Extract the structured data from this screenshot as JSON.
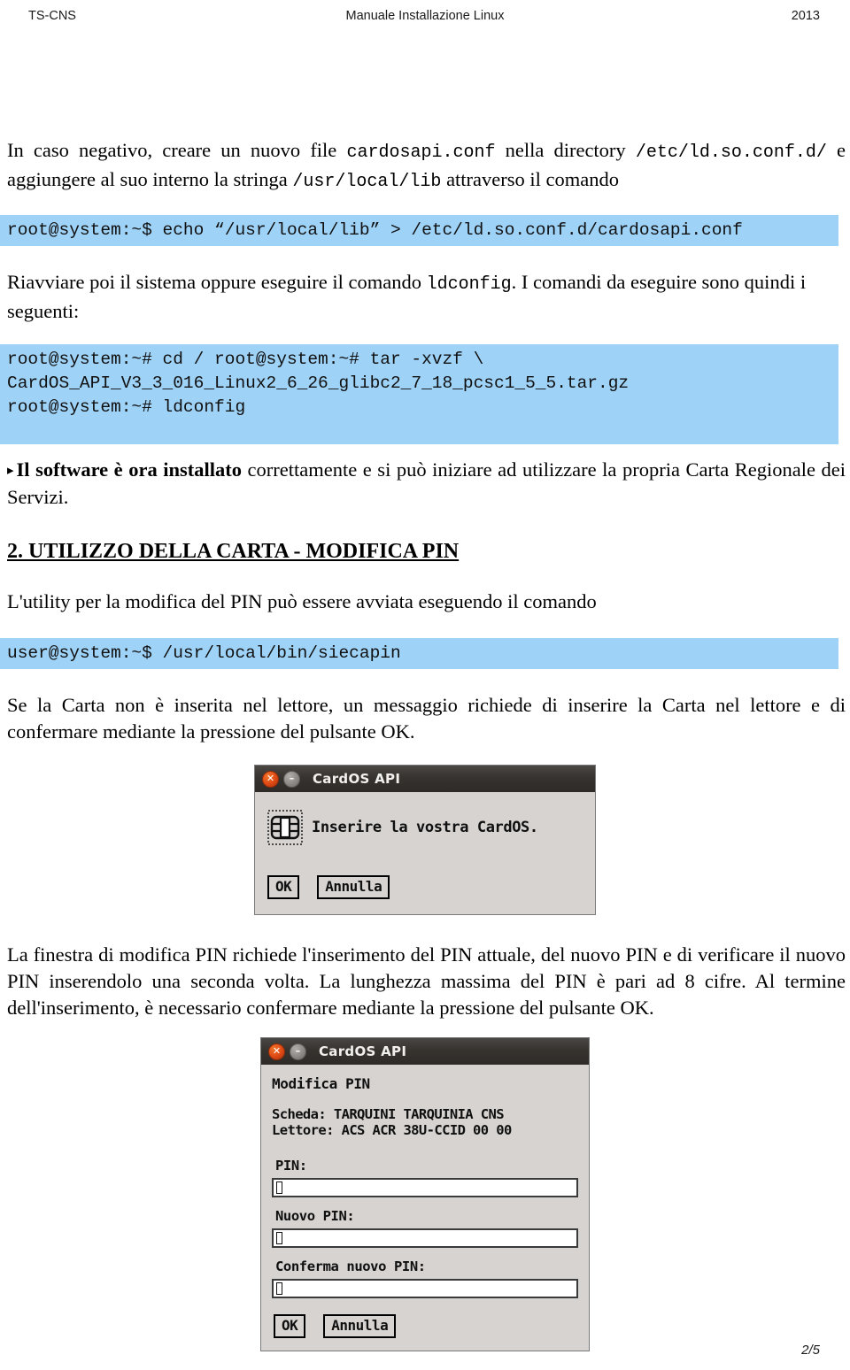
{
  "header": {
    "left": "TS-CNS",
    "center": "Manuale Installazione Linux",
    "right": "2013"
  },
  "body": {
    "para1_a": "In caso negativo, creare un nuovo file ",
    "para1_code1": "cardosapi.conf",
    "para1_b": " nella directory ",
    "para1_code2": "/etc/ld.so.conf.d/",
    "para1_c": " e aggiungere al suo interno la stringa ",
    "para1_code3": "/usr/local/lib",
    "para1_d": " attraverso il comando",
    "code1": "root@system:~$ echo “/usr/local/lib” > /etc/ld.so.conf.d/cardosapi.conf",
    "para2_a": "Riavviare poi il sistema oppure eseguire il comando ",
    "para2_code": "ldconfig",
    "para2_b": ". I comandi da eseguire sono quindi i seguenti:",
    "code2": "root@system:~# cd / root@system:~# tar -xvzf \\\nCardOS_API_V3_3_016_Linux2_6_26_glibc2_7_18_pcsc1_5_5.tar.gz\nroot@system:~# ldconfig",
    "bullet_marker": "▸",
    "bullet_bold": "Il software è ora installato",
    "bullet_rest": " correttamente e si può iniziare ad utilizzare la propria Carta Regionale dei Servizi.",
    "section_title": "2. UTILIZZO DELLA CARTA - MODIFICA PIN",
    "para3": "L'utility per la modifica del PIN può essere avviata eseguendo il comando",
    "code3": "user@system:~$ /usr/local/bin/siecapin",
    "para4": "Se la Carta non è inserita nel lettore, un messaggio richiede di inserire la Carta nel lettore e di confermare mediante la pressione del pulsante OK.",
    "para5": "La finestra di modifica PIN richiede l'inserimento del PIN attuale, del nuovo PIN e di verificare il nuovo PIN inserendolo una seconda volta. La lunghezza massima del PIN è pari ad 8 cifre. Al termine dell'inserimento, è necessario confermare mediante la pressione del pulsante OK."
  },
  "dialog_insert": {
    "title": "CardOS API",
    "close_glyph": "✕",
    "minimize_glyph": "–",
    "icon": "smartcard-chip-icon",
    "message": "Inserire la vostra CardOS.",
    "ok_label": "OK",
    "cancel_label": "Annulla"
  },
  "dialog_pin": {
    "title": "CardOS API",
    "close_glyph": "✕",
    "minimize_glyph": "–",
    "heading": "Modifica PIN",
    "card_line": "Scheda: TARQUINI TARQUINIA CNS",
    "reader_line": "Lettore: ACS ACR 38U-CCID 00 00",
    "pin_label": "PIN:",
    "pin_value": "",
    "new_pin_label": "Nuovo PIN:",
    "new_pin_value": "",
    "confirm_pin_label": "Conferma nuovo PIN:",
    "confirm_pin_value": "",
    "ok_label": "OK",
    "cancel_label": "Annulla"
  },
  "footer": {
    "page_number": "2/5"
  },
  "colors": {
    "code_highlight": "#9fd2f7",
    "titlebar": "#37332f",
    "close_button": "#dd4814",
    "dialog_bg": "#d6d3d0"
  }
}
